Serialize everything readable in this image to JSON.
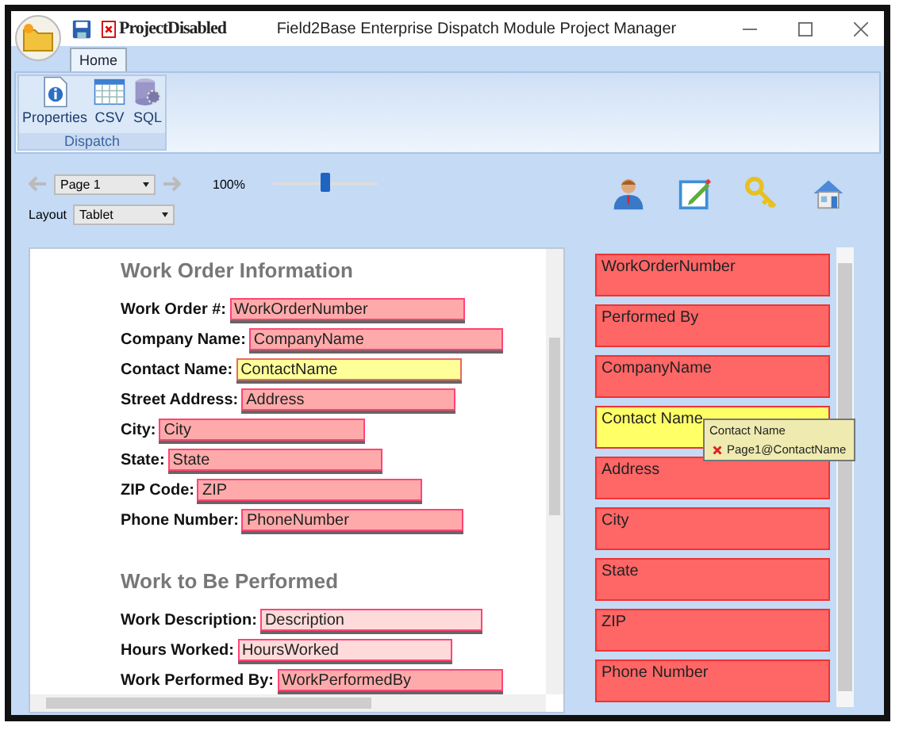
{
  "window": {
    "title": "Field2Base Enterprise Dispatch Module Project Manager",
    "project_status": "ProjectDisabled"
  },
  "tabs": [
    {
      "label": "Home",
      "selected": true
    }
  ],
  "ribbon": {
    "group": "Dispatch",
    "buttons": [
      {
        "label": "Properties",
        "kind": "properties"
      },
      {
        "label": "CSV",
        "kind": "csv"
      },
      {
        "label": "SQL",
        "kind": "sql"
      }
    ]
  },
  "toolbar": {
    "page": "Page 1",
    "zoom": "100%",
    "zoom_level": {
      "level": 0.5
    },
    "layout_label": "Layout",
    "layout": "Tablet"
  },
  "form": {
    "sections": [
      {
        "heading": "Work Order Information",
        "fields": [
          {
            "label": "Work Order #:",
            "value": "WorkOrderNumber",
            "selected": false,
            "faded": false
          },
          {
            "label": "Company Name:",
            "value": "CompanyName",
            "selected": false,
            "faded": false
          },
          {
            "label": "Contact Name:",
            "value": "ContactName",
            "selected": true,
            "faded": false
          },
          {
            "label": "Street Address:",
            "value": "Address",
            "selected": false,
            "faded": false
          },
          {
            "label": "City:",
            "value": "City",
            "selected": false,
            "faded": false
          },
          {
            "label": "State:",
            "value": "State",
            "selected": false,
            "faded": false
          },
          {
            "label": "ZIP Code:",
            "value": "ZIP",
            "selected": false,
            "faded": false
          },
          {
            "label": "Phone Number:",
            "value": "PhoneNumber",
            "selected": false,
            "faded": false
          }
        ]
      },
      {
        "heading": "Work to Be Performed",
        "fields": [
          {
            "label": "Work Description:",
            "value": "Description",
            "selected": false,
            "faded": true
          },
          {
            "label": "Hours Worked:",
            "value": "HoursWorked",
            "selected": false,
            "faded": true
          },
          {
            "label": "Work Performed By:",
            "value": "WorkPerformedBy",
            "selected": false,
            "faded": false
          }
        ]
      }
    ]
  },
  "field_list": [
    {
      "label": "WorkOrderNumber",
      "selected": false
    },
    {
      "label": "Performed By",
      "selected": false
    },
    {
      "label": "CompanyName",
      "selected": false
    },
    {
      "label": "Contact Name",
      "selected": true
    },
    {
      "label": "Address",
      "selected": false
    },
    {
      "label": "City",
      "selected": false
    },
    {
      "label": "State",
      "selected": false
    },
    {
      "label": "ZIP",
      "selected": false
    },
    {
      "label": "Phone Number",
      "selected": false
    }
  ],
  "tooltip": {
    "title": "Contact Name",
    "entry": "Page1@ContactName"
  }
}
